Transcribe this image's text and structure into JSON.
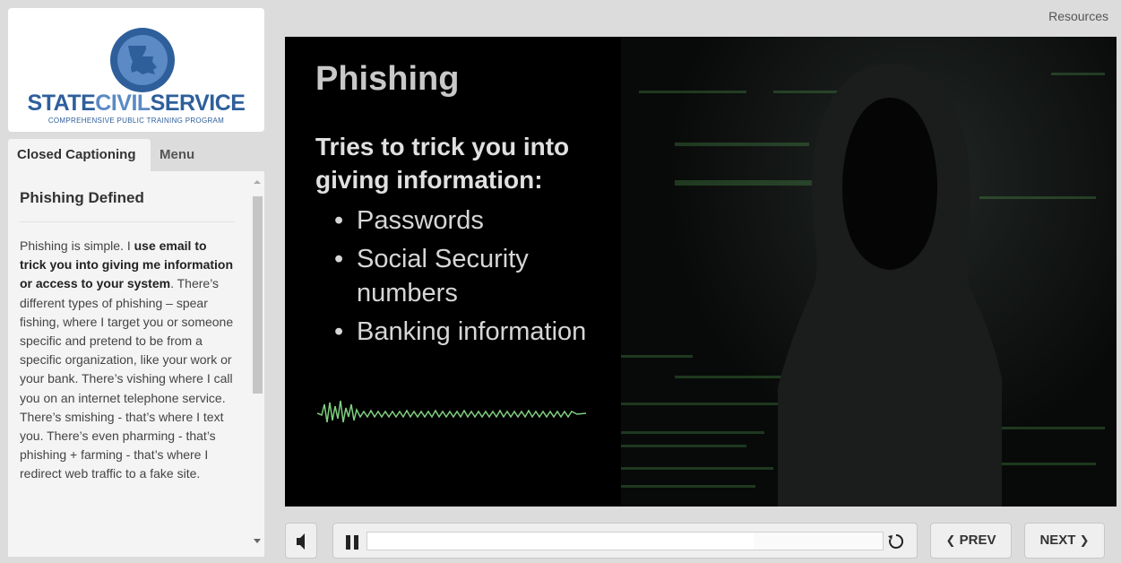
{
  "logo": {
    "title_part1": "STATE",
    "title_part2": "CIVIL",
    "title_part3": "SERVICE",
    "subtitle": "COMPREHENSIVE PUBLIC TRAINING PROGRAM"
  },
  "tabs": [
    {
      "label": "Closed Captioning",
      "active": true
    },
    {
      "label": "Menu",
      "active": false
    }
  ],
  "caption": {
    "heading": "Phishing Defined",
    "text_1": "Phishing is simple. I ",
    "text_bold": "use email to trick you into giving me information or access to your system",
    "text_2": ". There’s different types of phishing – spear fishing, where I target you or someone specific and pretend to be from a specific organization, like your work or your bank. There’s vishing where I call you on an internet telephone service. There’s smishing - that’s where I text you. There’s even pharming - that’s phishing + farming - that’s where I redirect web traffic to a fake site."
  },
  "header": {
    "resources": "Resources"
  },
  "slide": {
    "title": "Phishing",
    "subtitle": "Tries to trick you into giving information:",
    "bullets": [
      "Passwords",
      "Social Security numbers",
      "Banking information"
    ]
  },
  "controls": {
    "prev_label": "PREV",
    "next_label": "NEXT",
    "progress": 0.75
  },
  "colors": {
    "brand": "#2e5f9b",
    "brand_light": "#5b8ac4",
    "wave": "#7fd07f"
  },
  "icons": [
    "volume-icon",
    "pause-icon",
    "replay-icon",
    "chevron-left-icon",
    "chevron-right-icon",
    "scroll-up-icon",
    "scroll-down-icon"
  ]
}
